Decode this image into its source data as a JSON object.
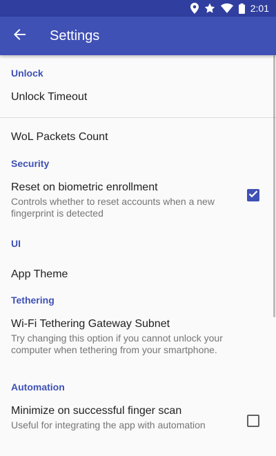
{
  "status_bar": {
    "time": "2:01",
    "icons": [
      "location-icon",
      "star-icon",
      "wifi-icon",
      "battery-icon"
    ]
  },
  "app_bar": {
    "title": "Settings",
    "back_icon": "arrow-back-icon",
    "color": "#3f51b5"
  },
  "sections": {
    "unlock": {
      "header": "Unlock",
      "unlock_timeout": "Unlock Timeout",
      "wol_packets": "WoL Packets Count"
    },
    "security": {
      "header": "Security",
      "reset_title": "Reset on biometric enrollment",
      "reset_summary": "Controls whether to reset accounts when a new fingerprint is detected",
      "reset_checked": true
    },
    "ui": {
      "header": "UI",
      "app_theme": "App Theme"
    },
    "tethering": {
      "header": "Tethering",
      "subnet_title": "Wi-Fi Tethering Gateway Subnet",
      "subnet_summary": "Try changing this option if you cannot unlock your computer when tethering from your smartphone."
    },
    "automation": {
      "header": "Automation",
      "minimize_title": "Minimize on successful finger scan",
      "minimize_summary": "Useful for integrating the app with automation",
      "minimize_checked": false
    }
  }
}
